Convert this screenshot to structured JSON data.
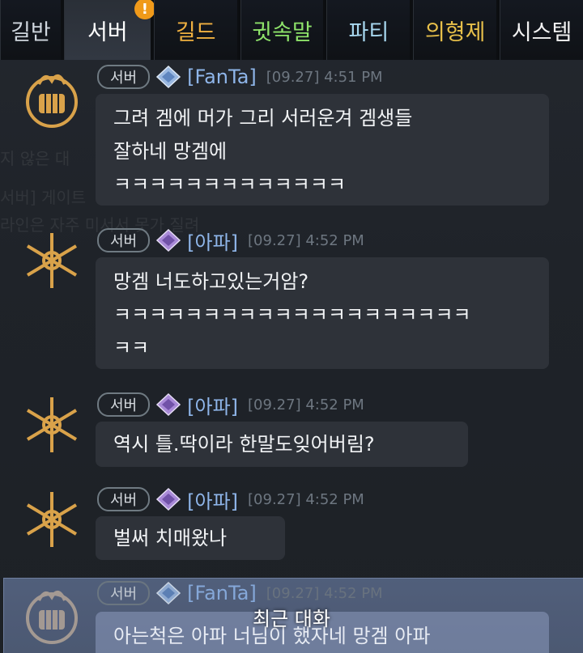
{
  "tabs": [
    {
      "label": "길반",
      "color": "#cfd6dd",
      "active": false
    },
    {
      "label": "서버",
      "color": "#ffffff",
      "active": true,
      "alert": "!"
    },
    {
      "label": "길드",
      "color": "#f0b040",
      "active": false
    },
    {
      "label": "귓속말",
      "color": "#8ee36a",
      "active": false
    },
    {
      "label": "파티",
      "color": "#a8d8f0",
      "active": false
    },
    {
      "label": "의형제",
      "color": "#e8c04a",
      "active": false
    },
    {
      "label": "시스템",
      "color": "#f2f2f2",
      "active": false
    }
  ],
  "background_ghost_text": [
    "지 않은 대",
    "서버] 게이트",
    "라인은 자주 미서서 못가 질려"
  ],
  "messages": [
    {
      "channel": "서버",
      "sender": "[FanTa]",
      "time": "[09.27] 4:51 PM",
      "avatar_icon": "fist-emblem-icon",
      "rank_icon": "diamond-rank-icon",
      "text": "그려 겜에 머가 그리 서러운겨 겜생들\n잘하네 망겜에\nㅋㅋㅋㅋㅋㅋㅋㅋㅋㅋㅋㅋㅋ"
    },
    {
      "channel": "서버",
      "sender": "[아파]",
      "time": "[09.27] 4:52 PM",
      "avatar_icon": "snowflake-emblem-icon",
      "rank_icon": "purple-rank-icon",
      "text": "망겜 너도하고있는거암?\nㅋㅋㅋㅋㅋㅋㅋㅋㅋㅋㅋㅋㅋㅋㅋㅋㅋㅋㅋㅋ\nㅋㅋ"
    },
    {
      "channel": "서버",
      "sender": "[아파]",
      "time": "[09.27] 4:52 PM",
      "avatar_icon": "snowflake-emblem-icon",
      "rank_icon": "purple-rank-icon",
      "text": "역시 틀.딱이라 한말도잊어버림?"
    },
    {
      "channel": "서버",
      "sender": "[아파]",
      "time": "[09.27] 4:52 PM",
      "avatar_icon": "snowflake-emblem-icon",
      "rank_icon": "purple-rank-icon",
      "text": "벌써 치매왔나"
    },
    {
      "channel": "서버",
      "sender": "[FanTa]",
      "time": "[09.27] 4:52 PM",
      "avatar_icon": "fist-emblem-icon",
      "rank_icon": "diamond-rank-icon",
      "text": "아는척은 아파 너님이 했자네 망겜 아파"
    }
  ],
  "recent_label": "최근 대화",
  "colors": {
    "sender": "#8fb6ea",
    "timestamp": "#6d7680",
    "bubble": "#2e3239",
    "highlight": "#5a6a8a",
    "avatar_gold": "#d9a24a"
  }
}
